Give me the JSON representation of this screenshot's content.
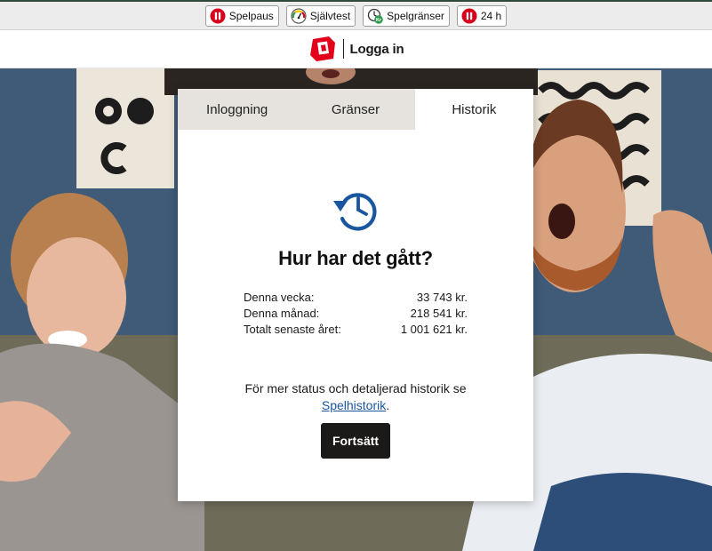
{
  "rg_bar": {
    "buttons": [
      {
        "label": "Spelpaus",
        "icon": "pause-icon"
      },
      {
        "label": "Självtest",
        "icon": "gauge-icon"
      },
      {
        "label": "Spelgränser",
        "icon": "limits-icon"
      },
      {
        "label": "24 h",
        "icon": "pause-icon"
      }
    ],
    "colors": {
      "pause_red": "#d6001c",
      "limits_green": "#2e9b4e"
    }
  },
  "header": {
    "login_label": "Logga in",
    "logo_icon": "svenska-spel-logo-icon",
    "logo_color": "#e3001b"
  },
  "modal": {
    "tabs": [
      {
        "label": "Inloggning",
        "active": false
      },
      {
        "label": "Gränser",
        "active": false
      },
      {
        "label": "Historik",
        "active": true
      }
    ],
    "icon": "history-icon",
    "icon_color": "#1a56a0",
    "title": "Hur har det gått?",
    "stats": [
      {
        "label": "Denna vecka:",
        "value": "33 743 kr."
      },
      {
        "label": "Denna månad:",
        "value": "218 541 kr."
      },
      {
        "label": "Totalt senaste året:",
        "value": "1 001 621 kr."
      }
    ],
    "info_text": "För mer status och detaljerad historik se",
    "info_link": "Spelhistorik",
    "info_suffix": ".",
    "continue_label": "Fortsätt"
  }
}
